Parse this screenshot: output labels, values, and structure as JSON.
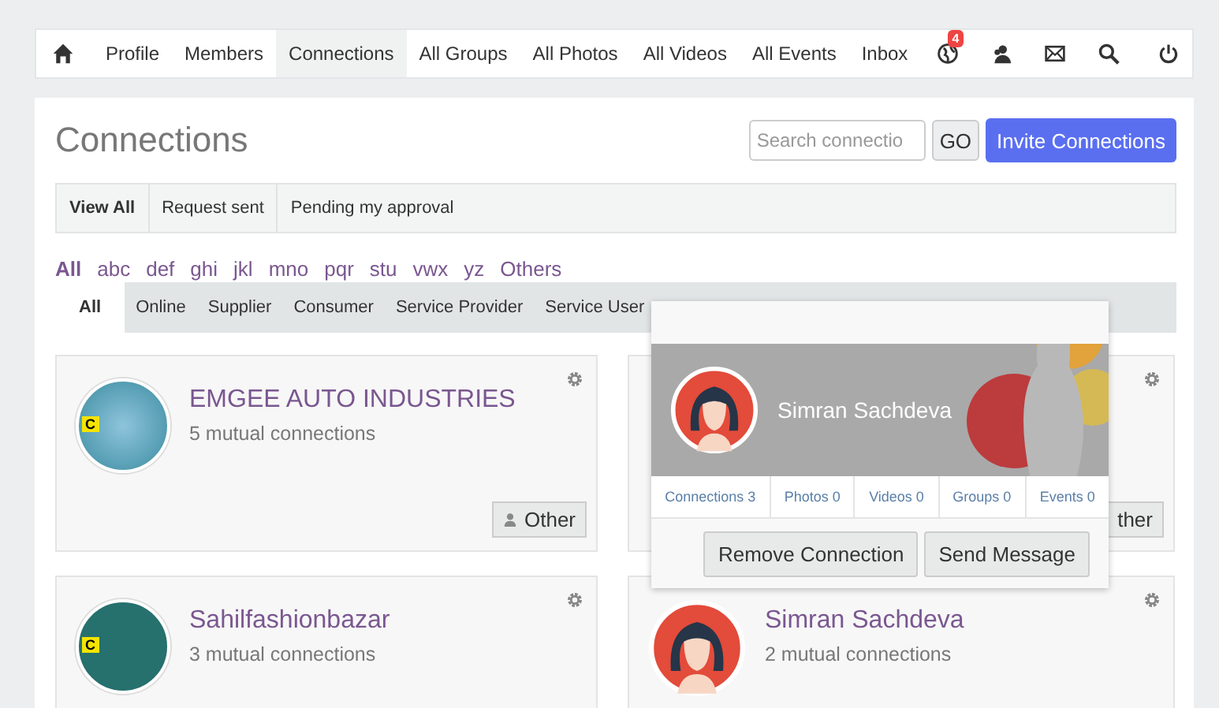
{
  "nav": {
    "items": [
      {
        "kind": "home"
      },
      {
        "kind": "text",
        "label": "Profile",
        "selected": false
      },
      {
        "kind": "text",
        "label": "Members",
        "selected": false
      },
      {
        "kind": "text",
        "label": "Connections",
        "selected": true
      },
      {
        "kind": "text",
        "label": "All Groups",
        "selected": false
      },
      {
        "kind": "text",
        "label": "All Photos",
        "selected": false
      },
      {
        "kind": "text",
        "label": "All Videos",
        "selected": false
      },
      {
        "kind": "text",
        "label": "All Events",
        "selected": false
      },
      {
        "kind": "text",
        "label": "Inbox",
        "selected": false
      },
      {
        "kind": "globe",
        "badge": "4"
      },
      {
        "kind": "users"
      },
      {
        "kind": "mail"
      },
      {
        "kind": "search"
      }
    ]
  },
  "page_title": "Connections",
  "search": {
    "placeholder": "Search connectio"
  },
  "go_button": "GO",
  "invite_button": "Invite Connections",
  "status_tabs": [
    {
      "label": "View All",
      "selected": true
    },
    {
      "label": "Request sent",
      "selected": false
    },
    {
      "label": "Pending my approval",
      "selected": false
    }
  ],
  "letters": [
    {
      "label": "All",
      "selected": true
    },
    {
      "label": "abc",
      "selected": false
    },
    {
      "label": "def",
      "selected": false
    },
    {
      "label": "ghi",
      "selected": false
    },
    {
      "label": "jkl",
      "selected": false
    },
    {
      "label": "mno",
      "selected": false
    },
    {
      "label": "pqr",
      "selected": false
    },
    {
      "label": "stu",
      "selected": false
    },
    {
      "label": "vwx",
      "selected": false
    },
    {
      "label": "yz",
      "selected": false
    },
    {
      "label": "Others",
      "selected": false
    }
  ],
  "type_tabs": [
    {
      "label": "All",
      "selected": true
    },
    {
      "label": "Online",
      "selected": false
    },
    {
      "label": "Supplier",
      "selected": false
    },
    {
      "label": "Consumer",
      "selected": false
    },
    {
      "label": "Service Provider",
      "selected": false
    },
    {
      "label": "Service User",
      "selected": false
    }
  ],
  "cards": [
    {
      "kind": "logo",
      "avatar_badge": "C",
      "name": "EMGEE AUTO INDUSTRIES",
      "mutual": "5 mutual connections",
      "tag": "Other"
    },
    {
      "kind": "covered",
      "tag": "ther"
    },
    {
      "kind": "logo",
      "avatar_badge": "C",
      "name": "Sahilfashionbazar",
      "mutual": "3 mutual connections"
    },
    {
      "kind": "female",
      "name": "Simran Sachdeva",
      "mutual": "2 mutual connections"
    }
  ],
  "popup": {
    "name": "Simran Sachdeva",
    "stats": [
      "Connections 3",
      "Photos 0",
      "Videos 0",
      "Groups 0",
      "Events 0"
    ],
    "buttons": [
      "Remove Connection",
      "Send Message"
    ]
  }
}
